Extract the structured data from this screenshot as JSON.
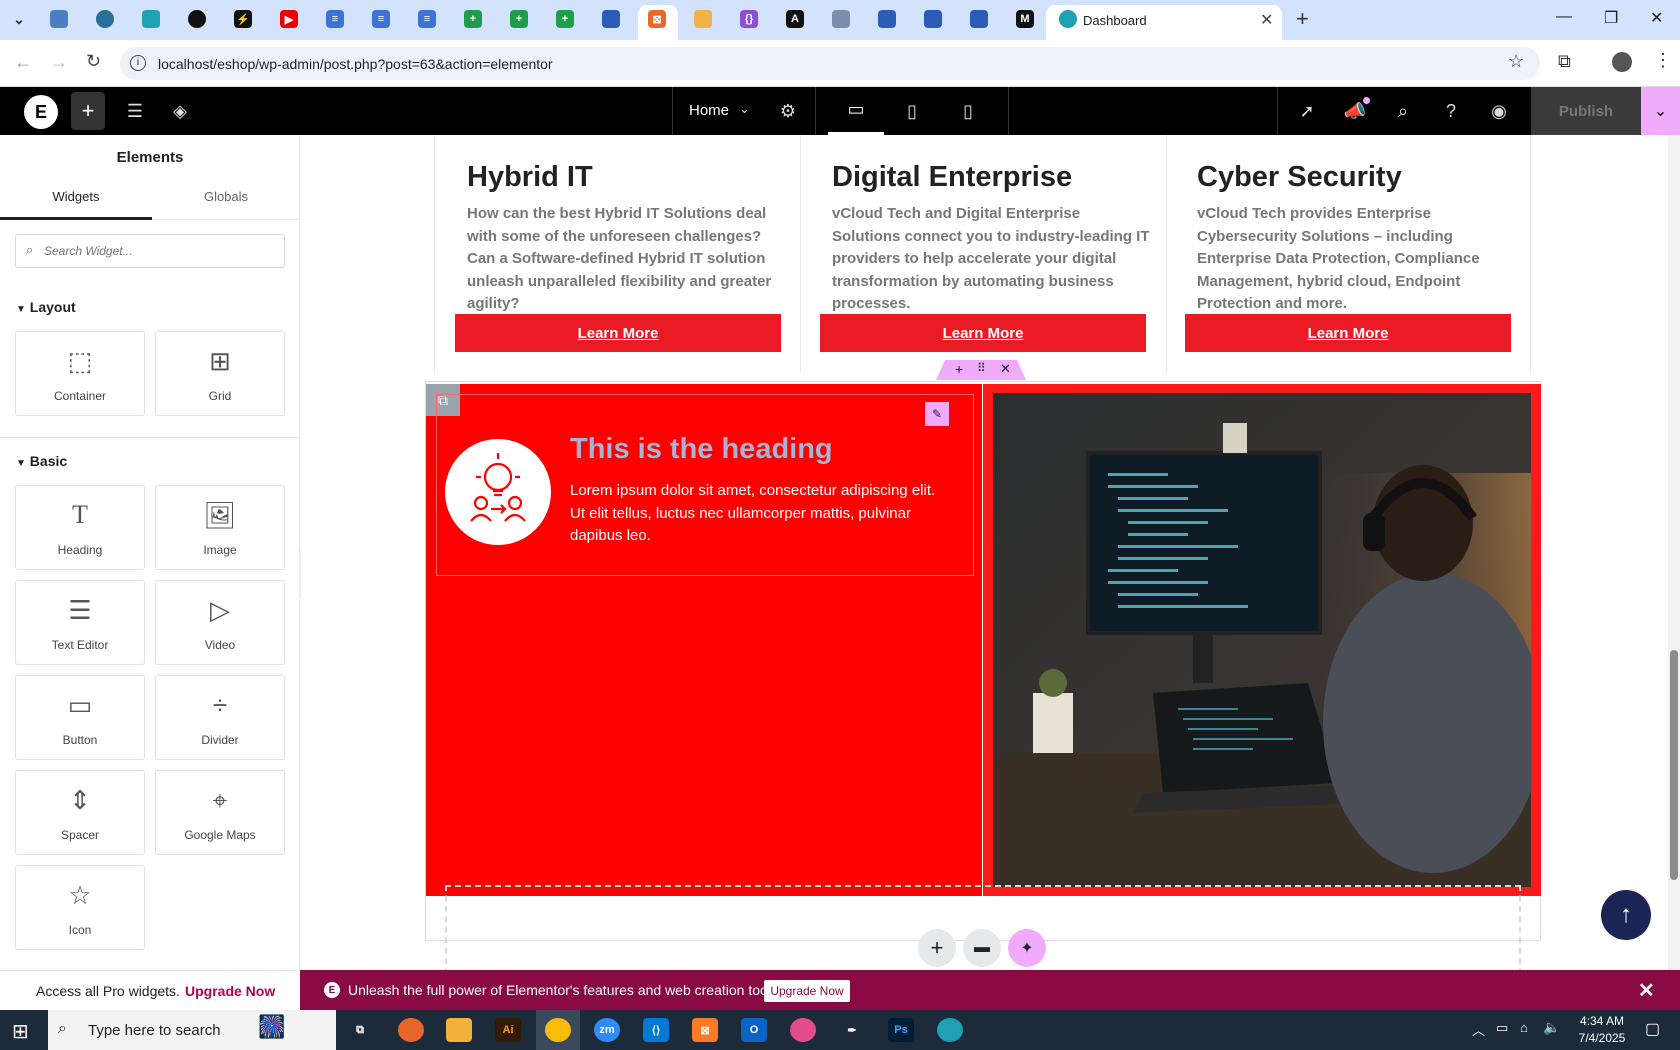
{
  "browser": {
    "active_tab_title": "Dashboard",
    "url": "localhost/eshop/wp-admin/post.php?post=63&action=elementor"
  },
  "editor": {
    "page_selector": "Home",
    "publish_label": "Publish"
  },
  "panel": {
    "title": "Elements",
    "tabs": [
      "Widgets",
      "Globals"
    ],
    "search_placeholder": "Search Widget...",
    "layout_title": "Layout",
    "layout_widgets": [
      {
        "label": "Container",
        "icon": "container-icon"
      },
      {
        "label": "Grid",
        "icon": "grid-icon"
      }
    ],
    "basic_title": "Basic",
    "basic_widgets": [
      {
        "label": "Heading",
        "icon": "heading-icon"
      },
      {
        "label": "Image",
        "icon": "image-icon"
      },
      {
        "label": "Text Editor",
        "icon": "text-editor-icon"
      },
      {
        "label": "Video",
        "icon": "video-icon"
      },
      {
        "label": "Button",
        "icon": "button-icon"
      },
      {
        "label": "Divider",
        "icon": "divider-icon"
      },
      {
        "label": "Spacer",
        "icon": "spacer-icon"
      },
      {
        "label": "Google Maps",
        "icon": "google-maps-icon"
      },
      {
        "label": "Icon",
        "icon": "star-icon"
      }
    ],
    "pro_text": "Access all Pro widgets.",
    "pro_link": "Upgrade Now"
  },
  "cards": [
    {
      "title": "Hybrid IT",
      "desc": "How can the best Hybrid IT Solutions deal with some of the unforeseen challenges? Can a Software-defined Hybrid IT solution unleash unparalleled flexibility and greater agility?",
      "button": "Learn More"
    },
    {
      "title": "Digital Enterprise",
      "desc": "vCloud Tech and Digital Enterprise Solutions connect you to industry-leading IT providers to help accelerate your digital transformation by automating business processes.",
      "button": "Learn More"
    },
    {
      "title": "Cyber Security",
      "desc": "vCloud Tech provides Enterprise Cybersecurity Solutions – including Enterprise Data Protection, Compliance Management, hybrid cloud, Endpoint Protection and more.",
      "button": "Learn More"
    }
  ],
  "feature": {
    "heading": "This is the heading",
    "text": "Lorem ipsum dolor sit amet, consectetur adipiscing elit. Ut elit tellus, luctus nec ullamcorper mattis, pulvinar dapibus leo."
  },
  "notice": {
    "text": "Unleash the full power of Elementor's features and web creation tools.",
    "button": "Upgrade Now"
  },
  "taskbar": {
    "search_placeholder": "Type here to search",
    "time": "4:34 AM",
    "date": "7/4/2025"
  },
  "colors": {
    "accent": "#ea1b25",
    "feature_bg": "#ff0000",
    "heading_color": "#a7b5d4",
    "notice_bg": "#8a0a44",
    "editor_pink": "#f0abfc"
  }
}
